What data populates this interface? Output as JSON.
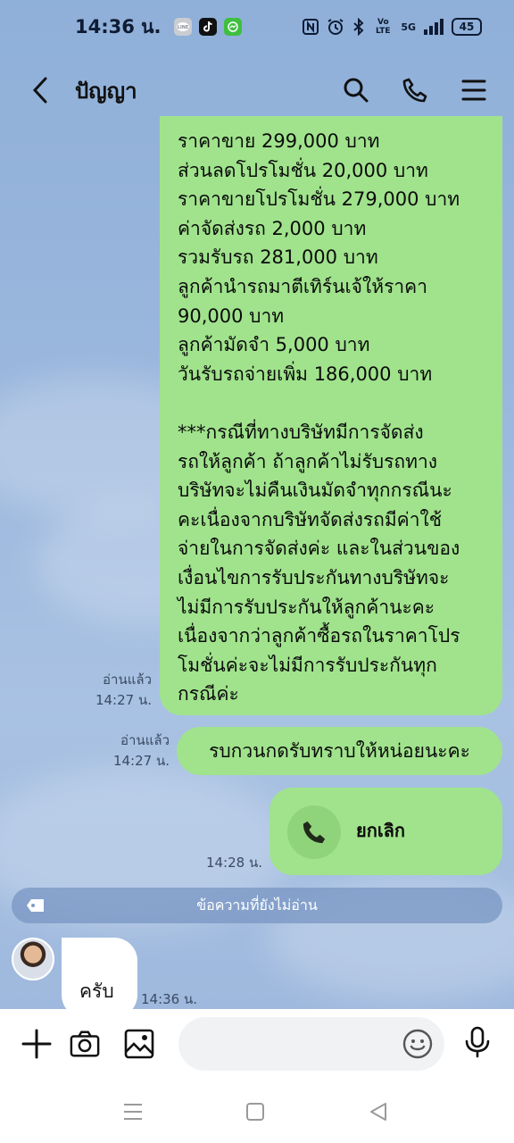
{
  "status_bar": {
    "time": "14:36 น.",
    "apps": [
      "LINE",
      "TikTok",
      "Messenger"
    ],
    "network": "5G",
    "volte": "Vo LTE",
    "battery": "45"
  },
  "header": {
    "back_icon": "chevron-left-icon",
    "title": "ปัญญา",
    "actions": [
      "search-icon",
      "phone-icon",
      "menu-icon"
    ]
  },
  "messages": {
    "long_message": {
      "text": "ราคาขาย 299,000 บาท\nส่วนลดโปรโมชั่น 20,000 บาท\nราคาขายโปรโมชั่น 279,000 บาท\nค่าจัดส่งรถ 2,000 บาท\nรวมรับรถ 281,000 บาท\nลูกค้านำรถมาตีเทิร์นเจ้ให้ราคา\n90,000 บาท\nลูกค้ามัดจำ 5,000 บาท\nวันรับรถจ่ายเพิ่ม 186,000 บาท\n\n***กรณีที่ทางบริษัทมีการจัดส่ง\nรถให้ลูกค้า ถ้าลูกค้าไม่รับรถทาง\nบริษัทจะไม่คืนเงินมัดจำทุกกรณีนะ\nคะเนื่องจากบริษัทจัดส่งรถมีค่าใช้\nจ่ายในการจัดส่งค่ะ และในส่วนของ\nเงื่อนไขการรับประกันทางบริษัทจะ\nไม่มีการรับประกันให้ลูกค้านะคะ\nเนื่องจากว่าลูกค้าซื้อรถในราคาโปร\nโมชั่นค่ะจะไม่มีการรับประกันทุก\nกรณีค่ะ",
      "read_label": "อ่านแล้ว",
      "time": "14:27 น."
    },
    "ack_message": {
      "text": "รบกวนกดรับทราบให้หน่อยนะคะ",
      "read_label": "อ่านแล้ว",
      "time": "14:27 น."
    },
    "call_message": {
      "text": "ยกเลิก",
      "icon": "phone-icon",
      "time": "14:28 น."
    },
    "unread_divider": {
      "text": "ข้อความที่ยังไม่อ่าน",
      "icon": "tag-icon"
    },
    "incoming_message": {
      "text": "ครับ",
      "time": "14:36 น."
    }
  },
  "input_bar": {
    "placeholder": "",
    "buttons": [
      "plus-icon",
      "camera-icon",
      "image-icon",
      "emoji-icon",
      "microphone-icon"
    ]
  },
  "nav_bar": {
    "buttons": [
      "recents-icon",
      "home-icon",
      "back-icon"
    ]
  },
  "colors": {
    "chat_background": "#9bb7dd",
    "outgoing_bubble": "#a0e38c",
    "incoming_bubble": "#ffffff"
  }
}
